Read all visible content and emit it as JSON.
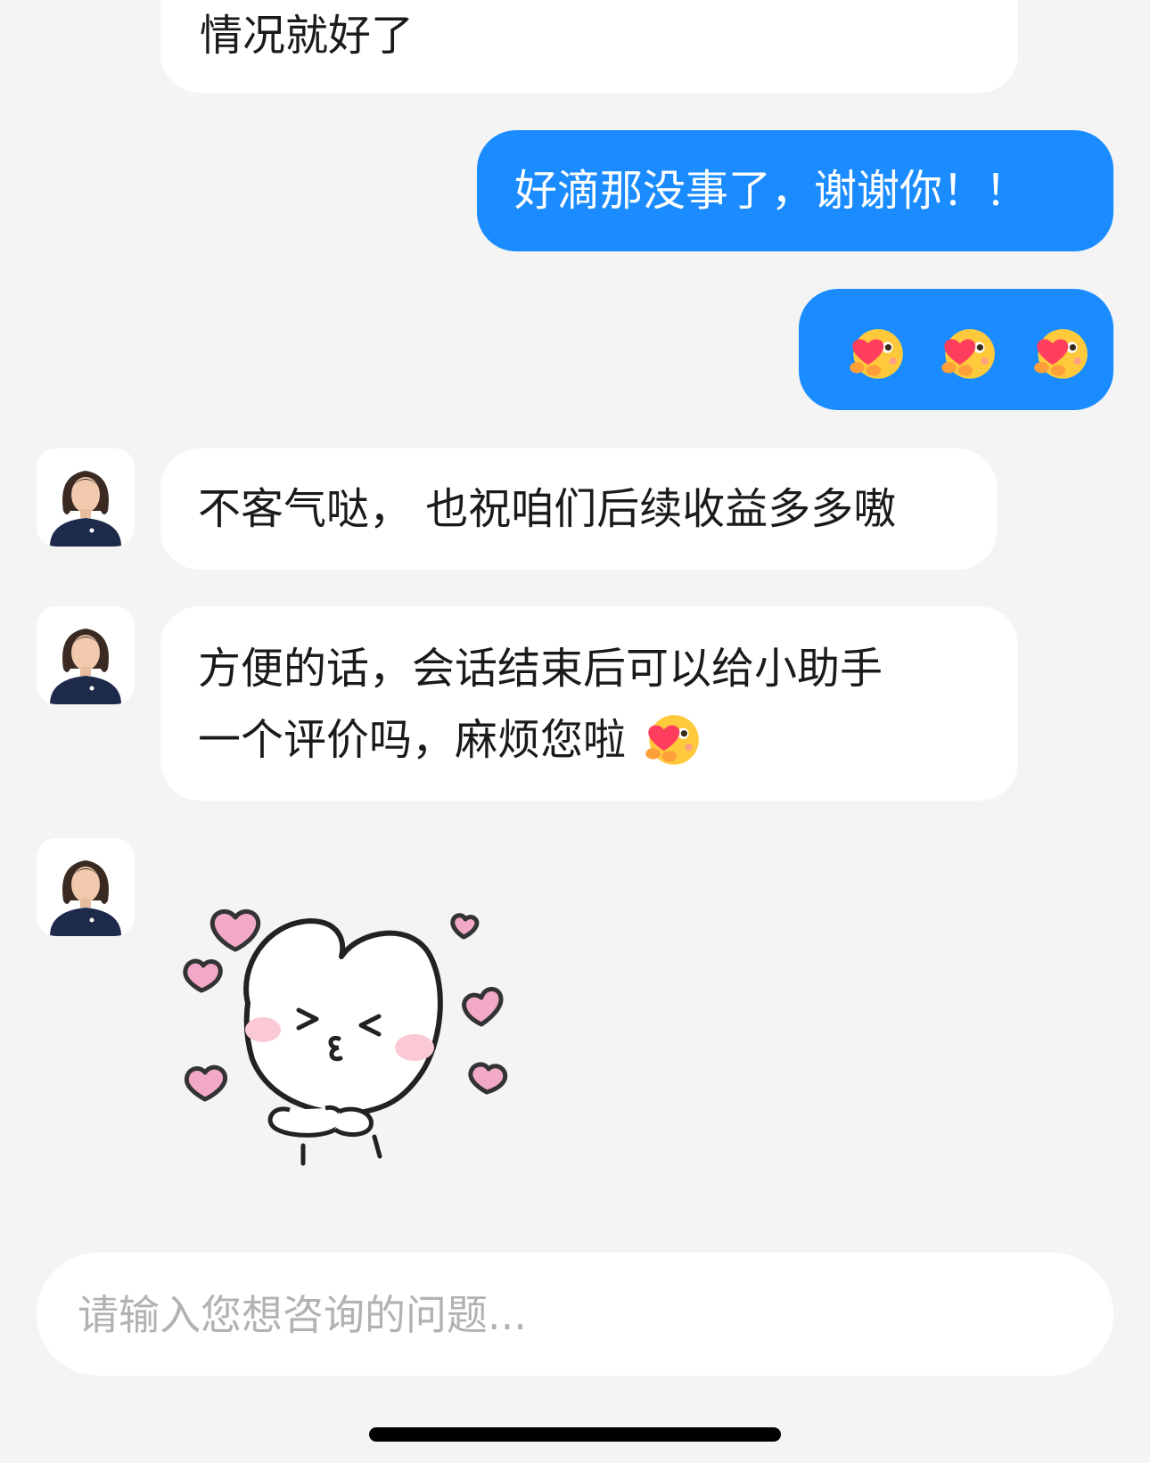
{
  "messages": [
    {
      "from": "assistant",
      "text": "情况就好了"
    },
    {
      "from": "user",
      "text": "好滴那没事了，谢谢你！！"
    },
    {
      "from": "user",
      "emojis": [
        "hug-heart-emoji",
        "hug-heart-emoji",
        "hug-heart-emoji"
      ]
    },
    {
      "from": "assistant",
      "text": "不客气哒，  也祝咱们后续收益多多嗷"
    },
    {
      "from": "assistant",
      "lines": [
        "方便的话，会话结束后可以给小助手",
        "一个评价吗，麻烦您啦"
      ],
      "emoji": "hug-heart-emoji"
    },
    {
      "from": "assistant",
      "sticker": "kissing-cat-with-hearts-sticker"
    }
  ],
  "composer": {
    "placeholder": "请输入您想咨询的问题..."
  },
  "colors": {
    "user_bubble": "#1a8cff",
    "assistant_bubble": "#ffffff",
    "background": "#f4f4f4",
    "heart_pink": "#f2a9c8"
  }
}
